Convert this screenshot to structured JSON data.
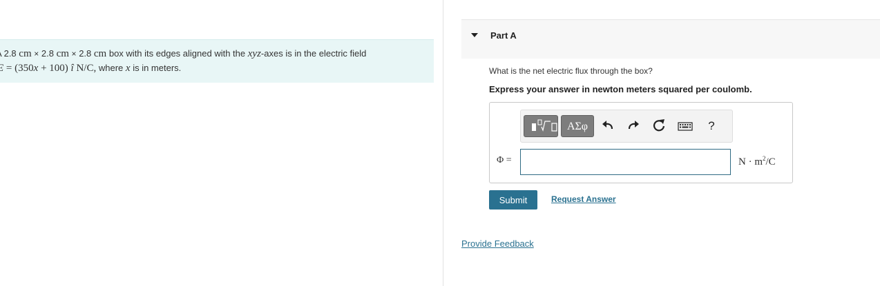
{
  "problem": {
    "line1_prefix": "A",
    "dim_value": "2.8",
    "dim_unit": "cm",
    "times": "×",
    "box_text": "box with its edges aligned with the",
    "axes_var": "xyz",
    "axes_text": "-axes is in the electric field",
    "field_symbol": "E",
    "field_eq": "= (350",
    "field_var": "x",
    "field_rest": "+ 100)",
    "unit_vector": "î",
    "field_unit": "N/C,",
    "where_text": "where",
    "where_var": "x",
    "where_rest": "is in meters."
  },
  "part": {
    "title": "Part A",
    "question": "What is the net electric flux through the box?",
    "instruction": "Express your answer in newton meters squared per coulomb."
  },
  "toolbar": {
    "greek_label": "ΑΣφ",
    "help_label": "?"
  },
  "answer": {
    "label": "Φ =",
    "value": "",
    "units_main": "N · m",
    "units_exp": "2",
    "units_tail": "/C"
  },
  "actions": {
    "submit_label": "Submit",
    "request_label": "Request Answer",
    "feedback_label": "Provide Feedback"
  },
  "colors": {
    "accent": "#2a7190",
    "problem_bg": "#e8f6f6",
    "toolbar_button": "#7d7d7d"
  }
}
